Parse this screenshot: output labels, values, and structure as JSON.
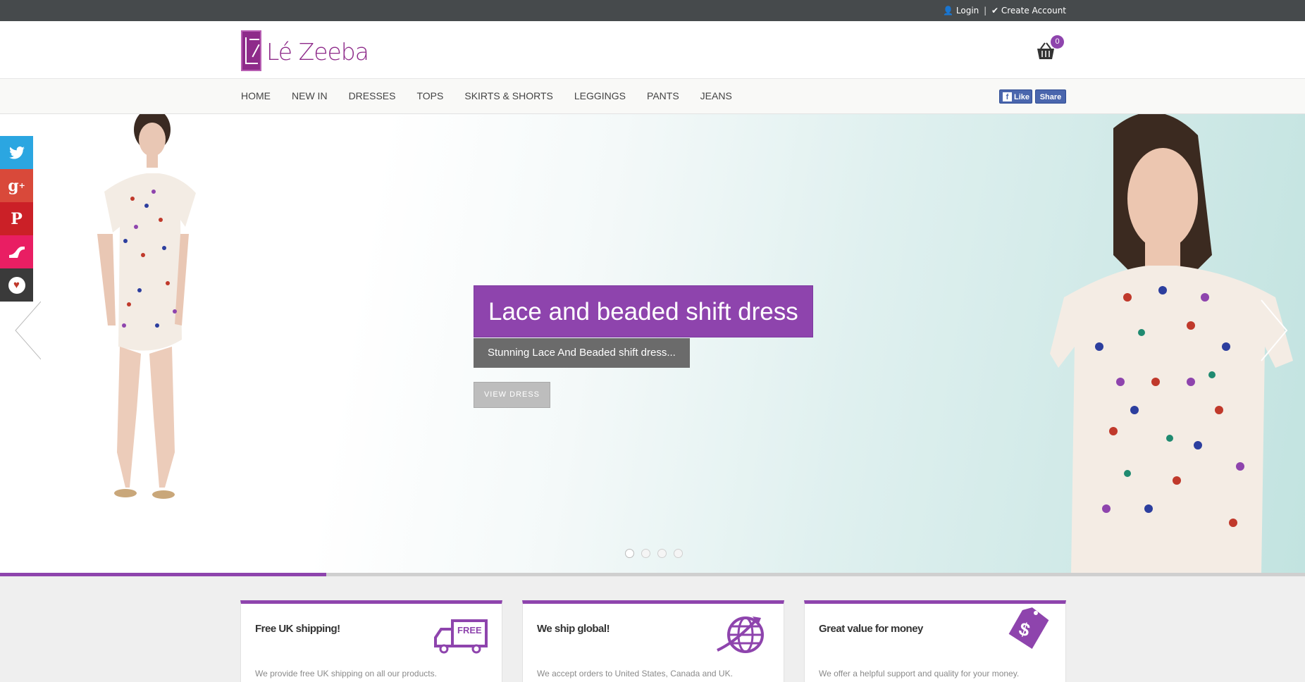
{
  "topbar": {
    "login_label": "Login",
    "separator": "|",
    "create_account_label": "Create Account"
  },
  "header": {
    "logo_text": "Lé Zeeba",
    "cart_count": "0"
  },
  "nav": {
    "items": [
      "HOME",
      "NEW IN",
      "DRESSES",
      "TOPS",
      "SKIRTS & SHORTS",
      "LEGGINGS",
      "PANTS",
      "JEANS"
    ]
  },
  "facebook": {
    "like_label": "Like",
    "share_label": "Share",
    "like_icon_text": "f"
  },
  "social": {
    "items": [
      {
        "name": "twitter-icon",
        "glyph": "🐦",
        "color": "#2ba6e1"
      },
      {
        "name": "google-plus-icon",
        "glyph": "g+",
        "color": "#d9493a"
      },
      {
        "name": "pinterest-icon",
        "glyph": "P",
        "color": "#cb2027"
      },
      {
        "name": "shoe-icon",
        "glyph": "◢",
        "color": "#e91e63"
      },
      {
        "name": "heart-icon",
        "glyph": "♥",
        "color": "#3a3a3a"
      }
    ]
  },
  "hero": {
    "title": "Lace and beaded shift dress",
    "subtitle": "Stunning Lace And Beaded shift dress...",
    "button_label": "VIEW DRESS",
    "slide_count": 4,
    "active_slide": 1,
    "progress": 0.25
  },
  "features": [
    {
      "title": "Free UK shipping!",
      "description": "We provide free UK shipping on all our products.",
      "icon": "free-shipping-truck-icon",
      "icon_text": "FREE"
    },
    {
      "title": "We ship global!",
      "description": "We accept orders to United States, Canada and UK.",
      "icon": "globe-plane-icon"
    },
    {
      "title": "Great value for money",
      "description": "We offer a helpful support and quality for your money.",
      "icon": "price-tag-icon",
      "icon_text": "$"
    }
  ],
  "colors": {
    "accent": "#8e44ad",
    "topbar": "#464a4c",
    "facebook": "#4a66ad"
  }
}
